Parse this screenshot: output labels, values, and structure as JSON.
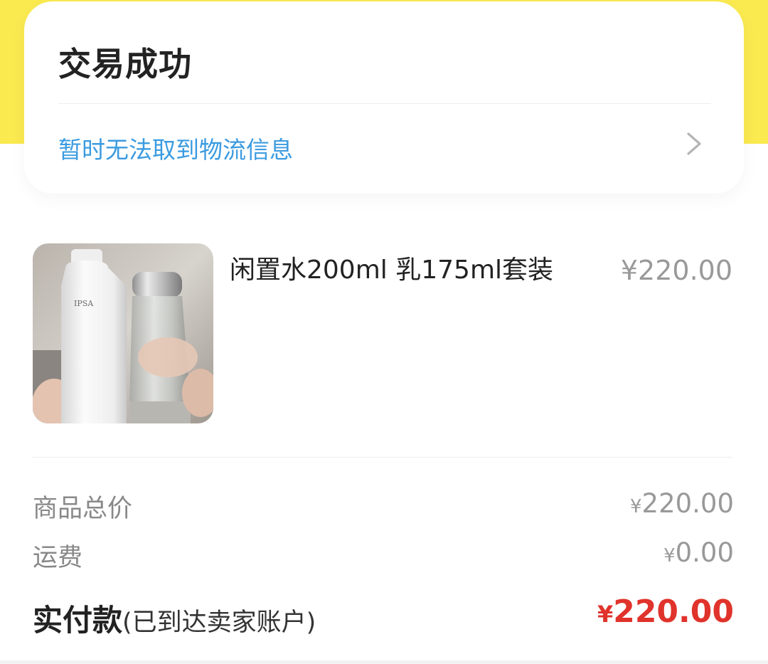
{
  "status": {
    "title": "交易成功",
    "logistics_text": "暂时无法取到物流信息"
  },
  "item": {
    "title": "闲置水200ml 乳175ml套装",
    "price": "¥220.00",
    "image_alt": "IPSA bottles photo",
    "image_brand_text": "IPSA"
  },
  "summary": {
    "goods_total_label": "商品总价",
    "goods_total_currency": "¥",
    "goods_total_amount": "220.00",
    "shipping_label": "运费",
    "shipping_currency": "¥",
    "shipping_amount": "0.00",
    "paid_label": "实付款",
    "paid_note": "(已到达卖家账户)",
    "paid_currency": "¥",
    "paid_amount": "220.00"
  },
  "colors": {
    "header_yellow": "#fae94f",
    "link_blue": "#3a9be0",
    "price_red": "#e0332b",
    "muted_gray": "#999999"
  },
  "icons": {
    "logistics_arrow": "chevron-right-icon"
  }
}
